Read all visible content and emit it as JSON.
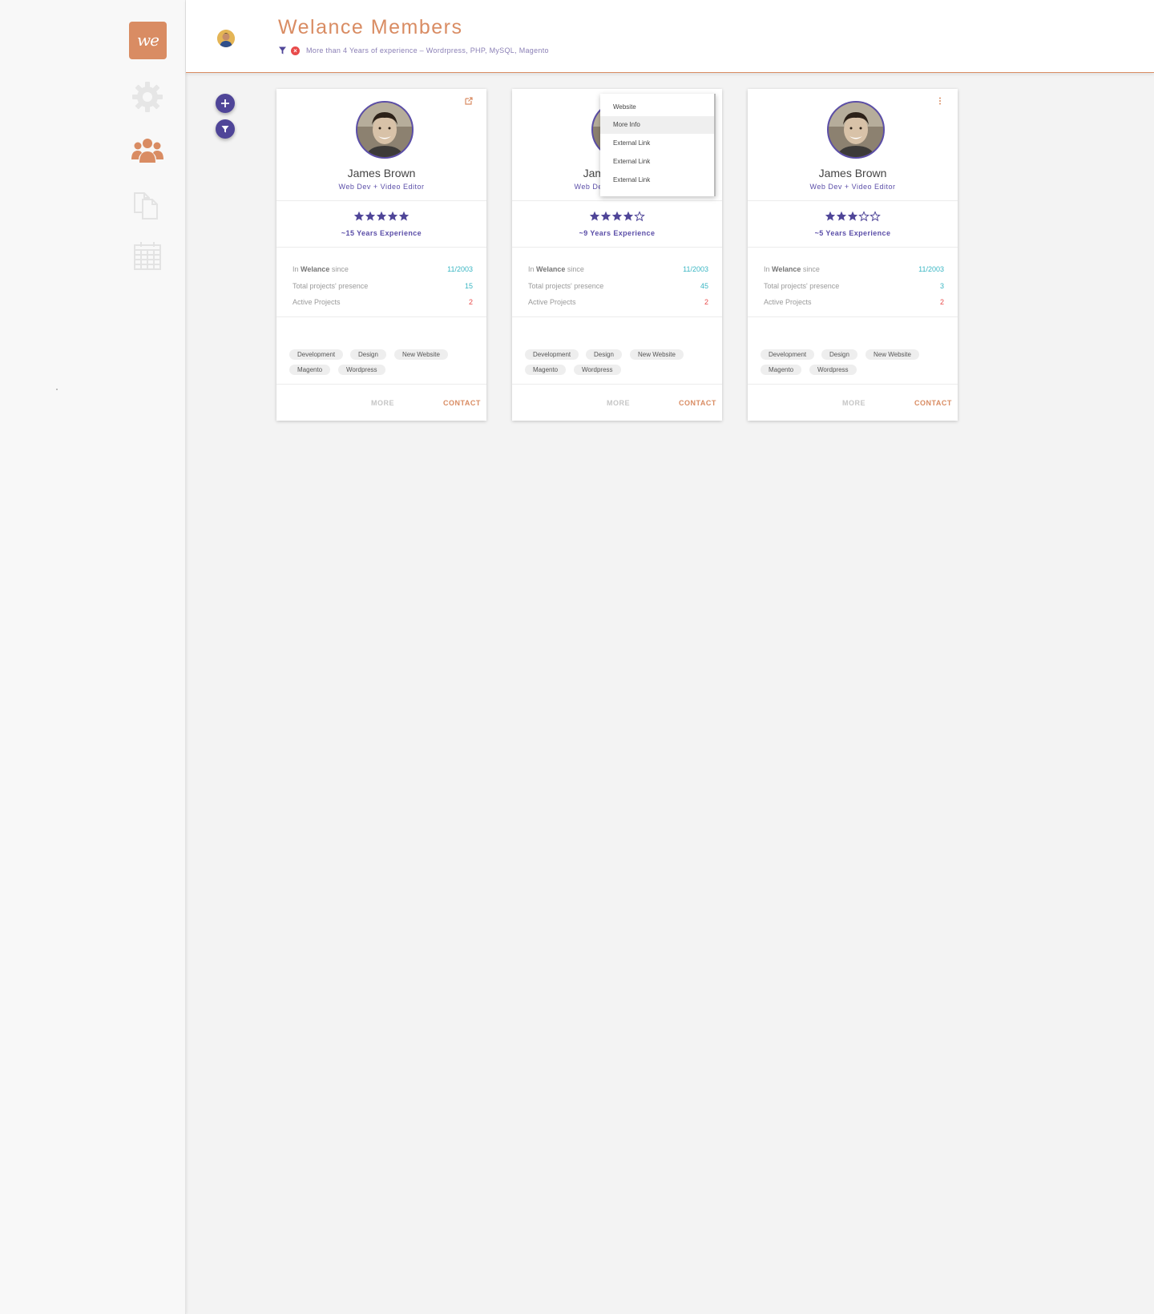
{
  "app": {
    "logo_text": "we",
    "title": "Welance Members"
  },
  "sidebar": {
    "items": [
      {
        "name": "settings",
        "icon": "gear-icon",
        "active": false
      },
      {
        "name": "members",
        "icon": "users-icon",
        "active": true
      },
      {
        "name": "documents",
        "icon": "documents-icon",
        "active": false
      },
      {
        "name": "calendar",
        "icon": "calendar-icon",
        "active": false
      }
    ]
  },
  "header": {
    "filter_text": "More than 4 Years of experience – Wordrpress, PHP, MySQL, Magento",
    "clear_symbol": "×"
  },
  "fabs": [
    {
      "icon": "plus-icon"
    },
    {
      "icon": "filter-icon"
    }
  ],
  "colors": {
    "accent": "#d98c63",
    "primary": "#4f4598",
    "teal": "#3ab6c3",
    "danger": "#e84a4a"
  },
  "cards": [
    {
      "name": "James Brown",
      "role": "Web Dev + Video Editor",
      "rating": 5,
      "rating_max": 5,
      "experience": "~15 Years Experience",
      "corner_icon": "external-link-icon",
      "stats": {
        "since_prefix": "In ",
        "since_bold": "Welance",
        "since_suffix": " since",
        "since_value": "11/2003",
        "projects_label": "Total projects' presence",
        "projects_value": "15",
        "active_label": "Active Projects",
        "active_value": "2"
      },
      "tags": [
        "Development",
        "Design",
        "New Website",
        "Magento",
        "Wordpress"
      ],
      "more_label": "MORE",
      "contact_label": "CONTACT"
    },
    {
      "name": "James Brown",
      "role": "Web Dev + Video Editor",
      "rating": 4,
      "rating_max": 5,
      "experience": "~9 Years Experience",
      "corner_icon": "more-vert-icon",
      "stats": {
        "since_prefix": "In ",
        "since_bold": "Welance",
        "since_suffix": " since",
        "since_value": "11/2003",
        "projects_label": "Total projects' presence",
        "projects_value": "45",
        "active_label": "Active Projects",
        "active_value": "2"
      },
      "tags": [
        "Development",
        "Design",
        "New Website",
        "Magento",
        "Wordpress"
      ],
      "more_label": "MORE",
      "contact_label": "CONTACT"
    },
    {
      "name": "James Brown",
      "role": "Web Dev + Video Editor",
      "rating": 3,
      "rating_max": 5,
      "experience": "~5 Years Experience",
      "corner_icon": "more-vert-icon",
      "stats": {
        "since_prefix": "In ",
        "since_bold": "Welance",
        "since_suffix": " since",
        "since_value": "11/2003",
        "projects_label": "Total projects' presence",
        "projects_value": "3",
        "active_label": "Active Projects",
        "active_value": "2"
      },
      "tags": [
        "Development",
        "Design",
        "New Website",
        "Magento",
        "Wordpress"
      ],
      "more_label": "MORE",
      "contact_label": "CONTACT"
    }
  ],
  "dropdown": {
    "items": [
      "Website",
      "More Info",
      "External Link",
      "External Link",
      "External Link"
    ],
    "highlighted": "More Info"
  }
}
